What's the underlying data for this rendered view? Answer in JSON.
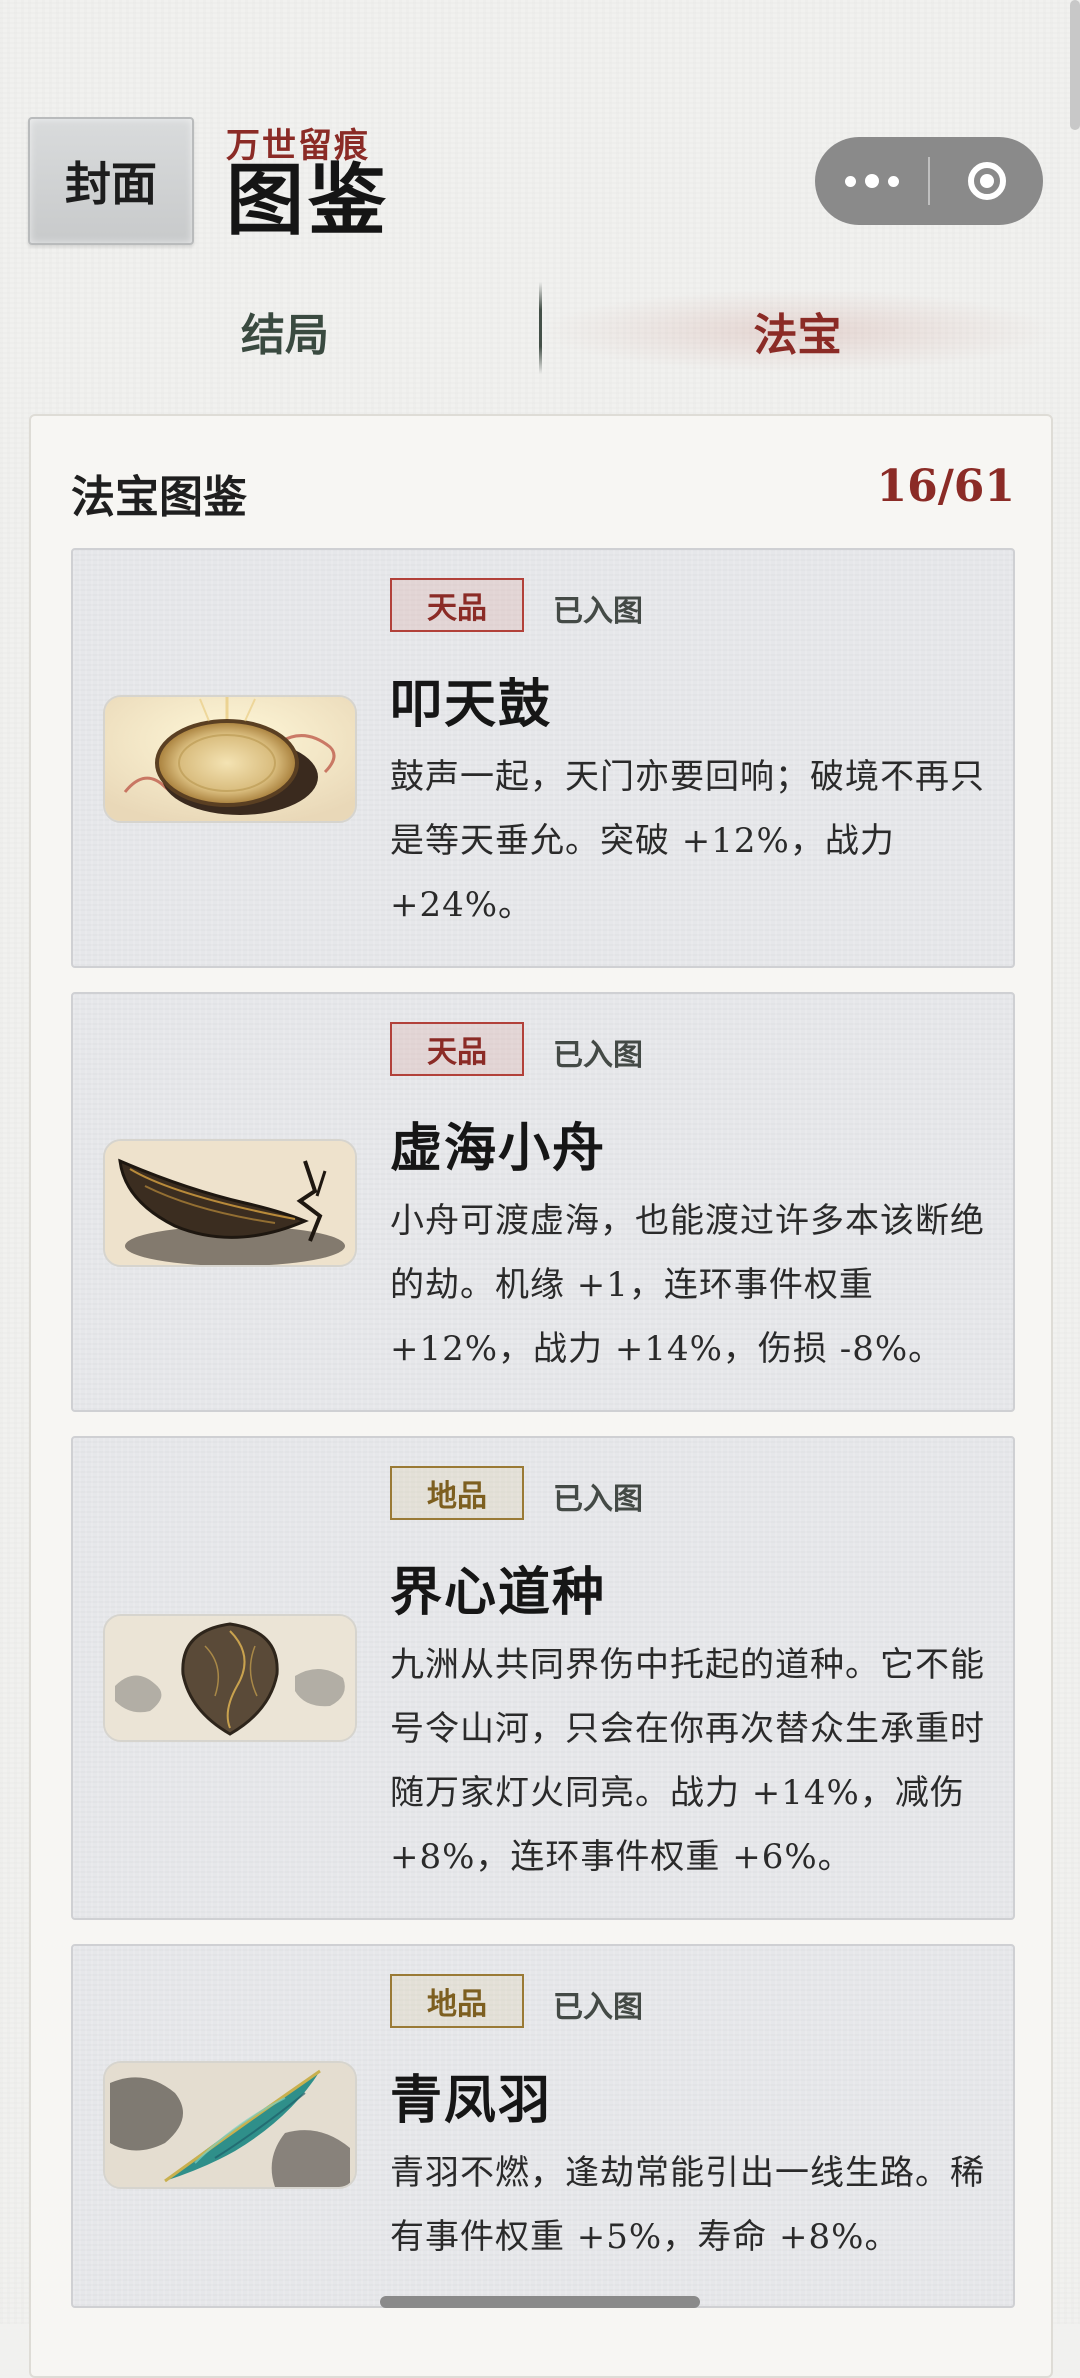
{
  "header": {
    "cover_label": "封面",
    "subtitle": "万世留痕",
    "title": "图鉴"
  },
  "tabs": [
    {
      "label": "结局",
      "active": false
    },
    {
      "label": "法宝",
      "active": true
    }
  ],
  "panel": {
    "title": "法宝图鉴",
    "count": "16/61"
  },
  "items": [
    {
      "grade": "天品",
      "status": "已入图",
      "name": "叩天鼓",
      "desc": "鼓声一起，天门亦要回响；破境不再只是等天垂允。突破 +12%，战力 +24%。",
      "icon": "drum-icon"
    },
    {
      "grade": "天品",
      "status": "已入图",
      "name": "虚海小舟",
      "desc": "小舟可渡虚海，也能渡过许多本该断绝的劫。机缘 +1，连环事件权重 +12%，战力 +14%，伤损 -8%。",
      "icon": "boat-icon"
    },
    {
      "grade": "地品",
      "status": "已入图",
      "name": "界心道种",
      "desc": "九洲从共同界伤中托起的道种。它不能号令山河，只会在你再次替众生承重时随万家灯火同亮。战力 +14%，减伤 +8%，连环事件权重 +6%。",
      "icon": "seed-icon"
    },
    {
      "grade": "地品",
      "status": "已入图",
      "name": "青凤羽",
      "desc": "青羽不燃，逢劫常能引出一线生路。稀有事件权重 +5%，寿命 +8%。",
      "icon": "feather-icon"
    }
  ],
  "colors": {
    "accent_red": "#8b2b26",
    "tian_badge": "#b2413a",
    "di_badge": "#9a7a35",
    "capsule": "#8a8a8a"
  }
}
